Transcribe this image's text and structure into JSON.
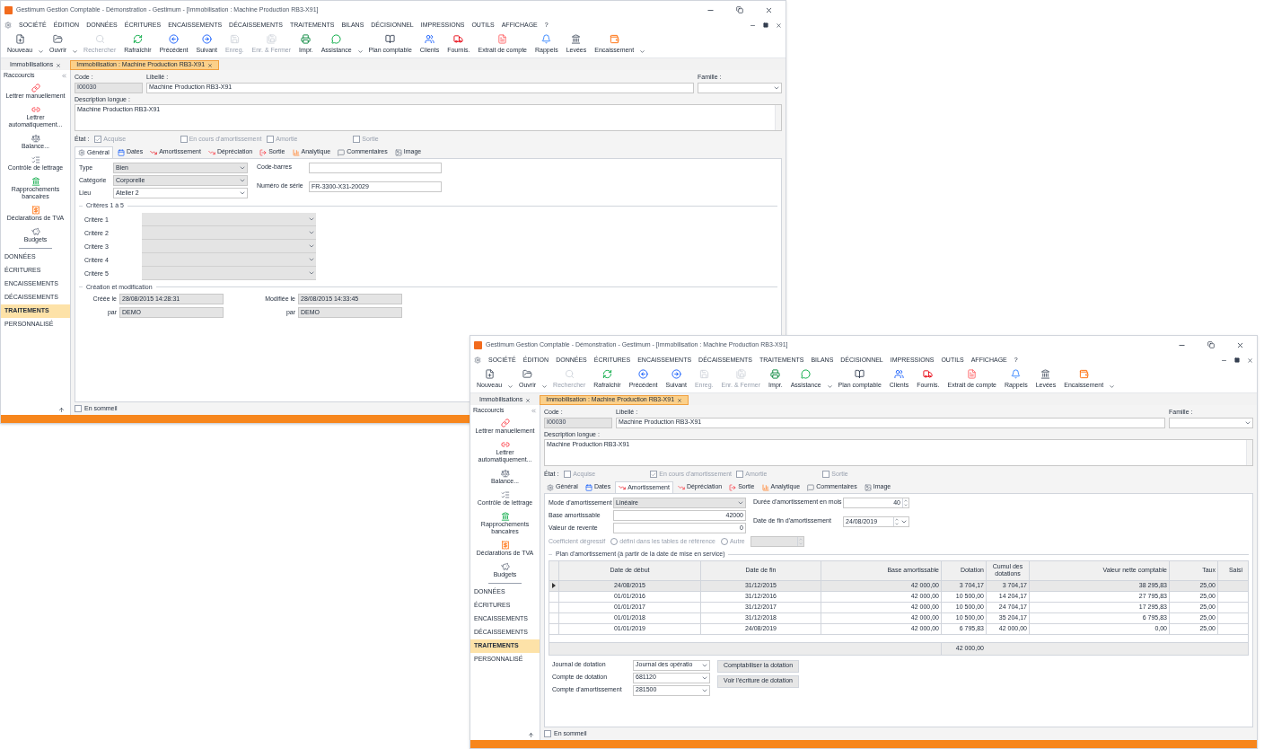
{
  "windows": [
    {
      "title": "Gestimum Gestion Comptable - Démonstration - Gestimum - [Immobilisation : Machine Production RB3-X91]",
      "menu": [
        "SOCIÉTÉ",
        "ÉDITION",
        "DONNÉES",
        "ÉCRITURES",
        "ENCAISSEMENTS",
        "DÉCAISSEMENTS",
        "TRAITEMENTS",
        "BILANS",
        "DÉCISIONNEL",
        "IMPRESSIONS",
        "OUTILS",
        "AFFICHAGE",
        "?"
      ],
      "toolbar": [
        {
          "label": "Nouveau",
          "disabled": false,
          "menu": true
        },
        {
          "label": "Ouvrir",
          "disabled": false,
          "menu": true
        },
        {
          "label": "Rechercher",
          "disabled": true,
          "menu": false
        },
        {
          "label": "Rafraîchir",
          "disabled": false,
          "menu": false
        },
        {
          "label": "Précédent",
          "disabled": false,
          "menu": false
        },
        {
          "label": "Suivant",
          "disabled": false,
          "menu": false
        },
        {
          "label": "Enreg.",
          "disabled": true,
          "menu": false
        },
        {
          "label": "Enr. & Fermer",
          "disabled": true,
          "menu": false
        },
        {
          "label": "Impr.",
          "disabled": false,
          "menu": false
        },
        {
          "label": "Assistance",
          "disabled": false,
          "menu": true
        },
        {
          "label": "Plan comptable",
          "disabled": false,
          "menu": false
        },
        {
          "label": "Clients",
          "disabled": false,
          "menu": false
        },
        {
          "label": "Fournis.",
          "disabled": false,
          "menu": false
        },
        {
          "label": "Extrait de compte",
          "disabled": false,
          "menu": false
        },
        {
          "label": "Rappels",
          "disabled": false,
          "menu": false
        },
        {
          "label": "Levées",
          "disabled": false,
          "menu": false
        },
        {
          "label": "Encaissement",
          "disabled": false,
          "menu": true
        }
      ],
      "doc_tabs": [
        {
          "label": "Immobilisations",
          "selected": false
        },
        {
          "label": "Immobilisation : Machine Production RB3-X91",
          "selected": true
        }
      ],
      "sidebar": {
        "title": "Raccourcis",
        "shortcuts": [
          "Lettrer manuellement",
          "Lettrer automatiquement...",
          "Balance...",
          "Contrôle de lettrage",
          "Rapprochements bancaires",
          "Déclarations de TVA",
          "Budgets"
        ],
        "sections": [
          {
            "label": "DONNÉES",
            "selected": false
          },
          {
            "label": "ÉCRITURES",
            "selected": false
          },
          {
            "label": "ENCAISSEMENTS",
            "selected": false
          },
          {
            "label": "DÉCAISSEMENTS",
            "selected": false
          },
          {
            "label": "TRAITEMENTS",
            "selected": true
          },
          {
            "label": "PERSONNALISÉ",
            "selected": false
          }
        ]
      },
      "header": {
        "code": {
          "label": "Code :",
          "value": "I00030",
          "disabled": true
        },
        "libelle": {
          "label": "Libellé :",
          "value": "Machine Production RB3-X91"
        },
        "famille": {
          "label": "Famille :"
        },
        "description": {
          "label": "Description longue :",
          "value": "Machine Production RB3-X91"
        },
        "etat": {
          "label": "État :",
          "options": [
            {
              "label": "Acquise",
              "checked": true
            },
            {
              "label": "En cours d'amortissement",
              "checked": false
            },
            {
              "label": "Amortie",
              "checked": false
            },
            {
              "label": "Sortie",
              "checked": false
            }
          ]
        }
      },
      "detail_tabs": [
        {
          "label": "Général",
          "selected": true
        },
        {
          "label": "Dates",
          "selected": false
        },
        {
          "label": "Amortissement",
          "selected": false
        },
        {
          "label": "Dépréciation",
          "selected": false
        },
        {
          "label": "Sortie",
          "selected": false
        },
        {
          "label": "Analytique",
          "selected": false
        },
        {
          "label": "Commentaires",
          "selected": false
        },
        {
          "label": "Image",
          "selected": false
        }
      ],
      "panel": {
        "kind": "general",
        "left_fields": [
          {
            "label": "Type",
            "value": "Bien",
            "kind": "combo",
            "disabled": true
          },
          {
            "label": "Catégorie",
            "value": "Corporelle",
            "kind": "combo",
            "disabled": true
          },
          {
            "label": "Lieu",
            "value": "Atelier 2",
            "kind": "combo",
            "disabled": false
          }
        ],
        "right_fields": [
          {
            "label": "Code-barres",
            "kind": "text",
            "disabled": false
          },
          {
            "label": "Numéro de série",
            "value": "FR-3300-X31-20029",
            "kind": "text",
            "disabled": false
          }
        ],
        "criteria": {
          "title": "Critères 1 à 5",
          "items": [
            {
              "label": "Critère 1",
              "disabled": true
            },
            {
              "label": "Critère 2",
              "disabled": true
            },
            {
              "label": "Critère 3",
              "disabled": true
            },
            {
              "label": "Critère 4",
              "disabled": true
            },
            {
              "label": "Critère 5",
              "disabled": true
            }
          ]
        },
        "creation": {
          "title": "Création et modification",
          "created_label": "Créée le",
          "created": "28/08/2015 14:28:31",
          "created_by_label": "par",
          "created_by": "DEMO",
          "modified_label": "Modifiée le",
          "modified": "28/08/2015 14:33:45",
          "modified_by_label": "par",
          "modified_by": "DEMO"
        }
      },
      "sleep": {
        "label": "En sommeil",
        "checked": false
      }
    },
    {
      "title": "Gestimum Gestion Comptable - Démonstration - Gestimum - [Immobilisation : Machine Production RB3-X91]",
      "menu": [
        "SOCIÉTÉ",
        "ÉDITION",
        "DONNÉES",
        "ÉCRITURES",
        "ENCAISSEMENTS",
        "DÉCAISSEMENTS",
        "TRAITEMENTS",
        "BILANS",
        "DÉCISIONNEL",
        "IMPRESSIONS",
        "OUTILS",
        "AFFICHAGE",
        "?"
      ],
      "toolbar": [
        {
          "label": "Nouveau",
          "disabled": false,
          "menu": true
        },
        {
          "label": "Ouvrir",
          "disabled": false,
          "menu": true
        },
        {
          "label": "Rechercher",
          "disabled": true,
          "menu": false
        },
        {
          "label": "Rafraîchir",
          "disabled": false,
          "menu": false
        },
        {
          "label": "Précédent",
          "disabled": false,
          "menu": false
        },
        {
          "label": "Suivant",
          "disabled": false,
          "menu": false
        },
        {
          "label": "Enreg.",
          "disabled": true,
          "menu": false
        },
        {
          "label": "Enr. & Fermer",
          "disabled": true,
          "menu": false
        },
        {
          "label": "Impr.",
          "disabled": false,
          "menu": false
        },
        {
          "label": "Assistance",
          "disabled": false,
          "menu": true
        },
        {
          "label": "Plan comptable",
          "disabled": false,
          "menu": false
        },
        {
          "label": "Clients",
          "disabled": false,
          "menu": false
        },
        {
          "label": "Fournis.",
          "disabled": false,
          "menu": false
        },
        {
          "label": "Extrait de compte",
          "disabled": false,
          "menu": false
        },
        {
          "label": "Rappels",
          "disabled": false,
          "menu": false
        },
        {
          "label": "Levées",
          "disabled": false,
          "menu": false
        },
        {
          "label": "Encaissement",
          "disabled": false,
          "menu": true
        }
      ],
      "doc_tabs": [
        {
          "label": "Immobilisations",
          "selected": false
        },
        {
          "label": "Immobilisation : Machine Production RB3-X91",
          "selected": true
        }
      ],
      "sidebar": {
        "title": "Raccourcis",
        "shortcuts": [
          "Lettrer manuellement",
          "Lettrer automatiquement...",
          "Balance...",
          "Contrôle de lettrage",
          "Rapprochements bancaires",
          "Déclarations de TVA",
          "Budgets"
        ],
        "sections": [
          {
            "label": "DONNÉES",
            "selected": false
          },
          {
            "label": "ÉCRITURES",
            "selected": false
          },
          {
            "label": "ENCAISSEMENTS",
            "selected": false
          },
          {
            "label": "DÉCAISSEMENTS",
            "selected": false
          },
          {
            "label": "TRAITEMENTS",
            "selected": true
          },
          {
            "label": "PERSONNALISÉ",
            "selected": false
          }
        ]
      },
      "header": {
        "code": {
          "label": "Code :",
          "value": "I00030",
          "disabled": true
        },
        "libelle": {
          "label": "Libellé :",
          "value": "Machine Production RB3-X91"
        },
        "famille": {
          "label": "Famille :"
        },
        "description": {
          "label": "Description longue :",
          "value": "Machine Production RB3-X91"
        },
        "etat": {
          "label": "État :",
          "options": [
            {
              "label": "Acquise",
              "checked": false
            },
            {
              "label": "En cours d'amortissement",
              "checked": true
            },
            {
              "label": "Amortie",
              "checked": false
            },
            {
              "label": "Sortie",
              "checked": false
            }
          ]
        }
      },
      "detail_tabs": [
        {
          "label": "Général",
          "selected": false
        },
        {
          "label": "Dates",
          "selected": false
        },
        {
          "label": "Amortissement",
          "selected": true
        },
        {
          "label": "Dépréciation",
          "selected": false
        },
        {
          "label": "Sortie",
          "selected": false
        },
        {
          "label": "Analytique",
          "selected": false
        },
        {
          "label": "Commentaires",
          "selected": false
        },
        {
          "label": "Image",
          "selected": false
        }
      ],
      "panel": {
        "kind": "amortissement",
        "left_fields": [
          {
            "label": "Mode d'amortissement",
            "value": "Linéaire",
            "kind": "combo",
            "disabled": true
          },
          {
            "label": "Base amortissable",
            "value": "42000",
            "kind": "number",
            "disabled": false
          },
          {
            "label": "Valeur de revente",
            "value": "0",
            "kind": "number",
            "disabled": false
          }
        ],
        "right_fields": [
          {
            "label": "Durée d'amortissement en mois",
            "value": "40",
            "kind": "spin",
            "disabled": false
          },
          {
            "label": "Date de fin d'amortissement",
            "value": "24/08/2019",
            "kind": "date",
            "disabled": false
          }
        ],
        "coefficient": {
          "label": "Coefficient dégressif",
          "options": [
            {
              "label": "défini dans les tables de référence",
              "selected": false
            },
            {
              "label": "Autre",
              "selected": false
            }
          ]
        },
        "plan": {
          "title": "Plan d'amortissement (à partir de la date de mise en service)",
          "columns": [
            "Date de début",
            "Date de fin",
            "Base amortissable",
            "Dotation",
            "Cumul des dotations",
            "Valeur nette comptable",
            "Taux",
            "Saisi"
          ],
          "rows": [
            {
              "cells": [
                "24/08/2015",
                "31/12/2015",
                "42 000,00",
                "3 704,17",
                "3 704,17",
                "38 295,83",
                "25,00"
              ],
              "selected": true
            },
            {
              "cells": [
                "01/01/2016",
                "31/12/2016",
                "42 000,00",
                "10 500,00",
                "14 204,17",
                "27 795,83",
                "25,00"
              ],
              "selected": false
            },
            {
              "cells": [
                "01/01/2017",
                "31/12/2017",
                "42 000,00",
                "10 500,00",
                "24 704,17",
                "17 295,83",
                "25,00"
              ],
              "selected": false
            },
            {
              "cells": [
                "01/01/2018",
                "31/12/2018",
                "42 000,00",
                "10 500,00",
                "35 204,17",
                "6 795,83",
                "25,00"
              ],
              "selected": false
            },
            {
              "cells": [
                "01/01/2019",
                "24/08/2019",
                "42 000,00",
                "6 795,83",
                "42 000,00",
                "0,00",
                "25,00"
              ],
              "selected": false
            }
          ],
          "dotation_total": "42 000,00"
        },
        "accounts": [
          {
            "label": "Journal de dotation",
            "value": "Journal des opératio"
          },
          {
            "label": "Compte de dotation",
            "value": "681120"
          },
          {
            "label": "Compte d'amortissement",
            "value": "281500"
          }
        ],
        "actions": [
          "Comptabiliser la dotation",
          "Voir l'écriture de dotation"
        ]
      },
      "sleep": {
        "label": "En sommeil",
        "checked": false
      }
    }
  ]
}
